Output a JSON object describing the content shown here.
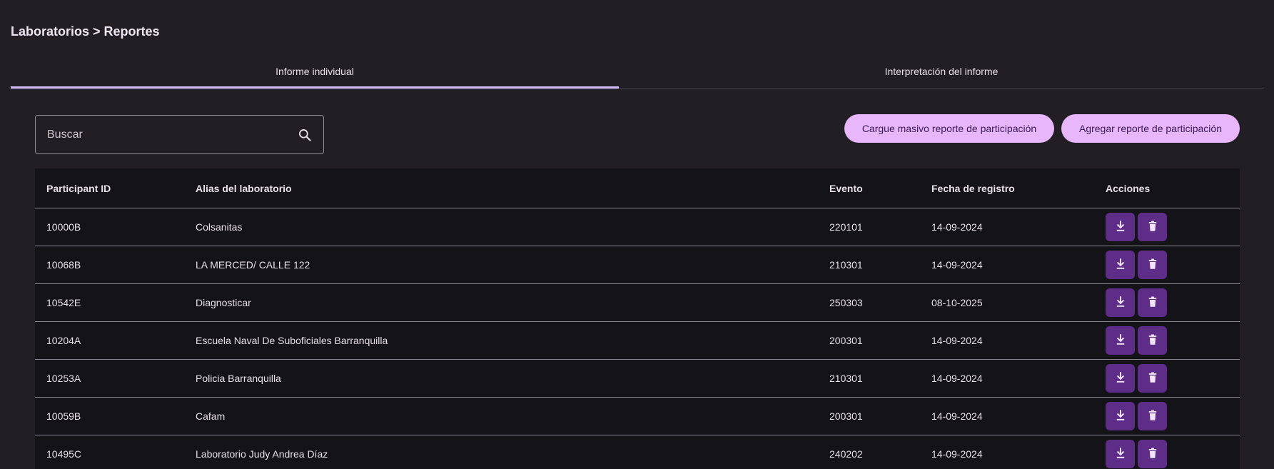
{
  "breadcrumb": "Laboratorios > Reportes",
  "tabs": [
    {
      "label": "Informe individual",
      "active": true
    },
    {
      "label": "Interpretación del informe",
      "active": false
    }
  ],
  "search": {
    "placeholder": "Buscar",
    "value": "",
    "icon": "search-icon"
  },
  "buttons": {
    "bulk_upload": "Cargue masivo reporte de participación",
    "add_report": "Agregar reporte de participación"
  },
  "table": {
    "headers": {
      "participant_id": "Participant ID",
      "alias": "Alias del laboratorio",
      "evento": "Evento",
      "fecha": "Fecha de registro",
      "acciones": "Acciones"
    },
    "rows": [
      {
        "participant_id": "10000B",
        "alias": "Colsanitas",
        "evento": "220101",
        "fecha": "14-09-2024"
      },
      {
        "participant_id": "10068B",
        "alias": "LA MERCED/ CALLE 122",
        "evento": "210301",
        "fecha": "14-09-2024"
      },
      {
        "participant_id": "10542E",
        "alias": "Diagnosticar",
        "evento": "250303",
        "fecha": "08-10-2025"
      },
      {
        "participant_id": "10204A",
        "alias": "Escuela Naval De Suboficiales Barranquilla",
        "evento": "200301",
        "fecha": "14-09-2024"
      },
      {
        "participant_id": "10253A",
        "alias": "Policia Barranquilla",
        "evento": "210301",
        "fecha": "14-09-2024"
      },
      {
        "participant_id": "10059B",
        "alias": "Cafam",
        "evento": "200301",
        "fecha": "14-09-2024"
      },
      {
        "participant_id": "10495C",
        "alias": "Laboratorio Judy Andrea Díaz",
        "evento": "240202",
        "fecha": "14-09-2024"
      }
    ],
    "row_actions": [
      "download-icon",
      "trash-icon"
    ]
  },
  "colors": {
    "background": "#211f24",
    "table_background": "#141317",
    "accent": "#d0bcff",
    "pill_button": "#e8b6fb",
    "action_button": "#5e2d87"
  }
}
